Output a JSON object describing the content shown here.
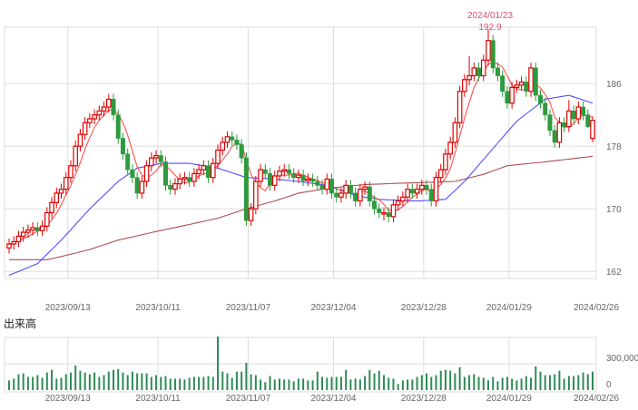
{
  "colors": {
    "up": "#e00000",
    "down": "#2e9a3e",
    "ma5": "#ff3030",
    "ma25": "#3030ff",
    "ma75": "#a03030",
    "volume": "#2e8b57",
    "grid": "#dddddd",
    "annotation": "#e05070"
  },
  "annotation": {
    "date": "2024/01/23",
    "value": "192.9"
  },
  "volume_title": "出来高",
  "chart_data": [
    {
      "type": "candlestick",
      "ylim": [
        161.1,
        193.2
      ],
      "y_ticks": [
        162,
        170,
        178,
        186
      ],
      "y_tick_labels": [
        "162",
        "170",
        "178",
        "186"
      ],
      "x_tick_labels": [
        "2023/09/13",
        "2023/10/11",
        "2023/11/07",
        "2023/12/04",
        "2023/12/28",
        "2024/01/29",
        "2024/02/26"
      ],
      "x_tick_index": [
        12,
        31,
        50,
        68,
        87,
        105,
        123
      ],
      "grid": true,
      "candles": [
        [
          165,
          166.2,
          164.3,
          165.5
        ],
        [
          165.5,
          166.5,
          164.8,
          165.8
        ],
        [
          165.8,
          167.2,
          165.1,
          166.5
        ],
        [
          166.5,
          167.7,
          165.8,
          167
        ],
        [
          167,
          168,
          166.3,
          167.3
        ],
        [
          167.3,
          168.3,
          166.6,
          167.6
        ],
        [
          167.6,
          168.3,
          166.5,
          167.2
        ],
        [
          167.2,
          168.5,
          166.5,
          167.8
        ],
        [
          167.8,
          170.2,
          167.1,
          169.5
        ],
        [
          169.5,
          171.5,
          168.8,
          170.8
        ],
        [
          170.8,
          172.7,
          170.1,
          172
        ],
        [
          172,
          173.2,
          171.3,
          172.5
        ],
        [
          172.5,
          174.7,
          171.8,
          174
        ],
        [
          174,
          176.2,
          173.3,
          175.5
        ],
        [
          175.5,
          178.7,
          174.8,
          178
        ],
        [
          178,
          180.2,
          177.3,
          179.5
        ],
        [
          179.5,
          181.7,
          178.8,
          181
        ],
        [
          181,
          182.2,
          180.3,
          181.5
        ],
        [
          181.5,
          182.7,
          180.8,
          182
        ],
        [
          182,
          183.2,
          181.3,
          182.5
        ],
        [
          182.5,
          183.7,
          181.8,
          183
        ],
        [
          183,
          184.7,
          182.3,
          184
        ],
        [
          184,
          184.7,
          181.3,
          182
        ],
        [
          182,
          182.7,
          178.3,
          179
        ],
        [
          179,
          179.7,
          176.3,
          177
        ],
        [
          177,
          177.7,
          174.3,
          175
        ],
        [
          175,
          175.7,
          173.3,
          174
        ],
        [
          174,
          174.7,
          171.3,
          172
        ],
        [
          172,
          174.2,
          171.3,
          173.5
        ],
        [
          173.5,
          176.2,
          172.8,
          175.5
        ],
        [
          175.5,
          177.2,
          174.8,
          176.5
        ],
        [
          176.5,
          177.5,
          175.8,
          176.8
        ],
        [
          176.8,
          177.5,
          175.3,
          176
        ],
        [
          176,
          176.7,
          172.3,
          173
        ],
        [
          173,
          173.7,
          171.8,
          172.5
        ],
        [
          172.5,
          173.9,
          171.8,
          173.2
        ],
        [
          173.2,
          174.5,
          172.5,
          173.8
        ],
        [
          173.8,
          174.7,
          173.1,
          174
        ],
        [
          174,
          174.7,
          172.8,
          173.5
        ],
        [
          173.5,
          175.2,
          172.8,
          174.5
        ],
        [
          174.5,
          175.7,
          173.8,
          175
        ],
        [
          175,
          176.2,
          174.3,
          175.5
        ],
        [
          175.5,
          176.2,
          173.3,
          174
        ],
        [
          174,
          176.5,
          173.3,
          175.8
        ],
        [
          175.8,
          178.2,
          175.1,
          177.5
        ],
        [
          177.5,
          179.2,
          176.8,
          178.5
        ],
        [
          178.5,
          179.9,
          177.8,
          179.2
        ],
        [
          179.2,
          179.9,
          178.1,
          178.8
        ],
        [
          178.8,
          179.5,
          177.5,
          178.2
        ],
        [
          178.2,
          178.9,
          175.8,
          176.5
        ],
        [
          176.5,
          177.2,
          167.8,
          168.5
        ],
        [
          168.5,
          170.7,
          167.8,
          170
        ],
        [
          170,
          174.2,
          169.3,
          173.5
        ],
        [
          173.5,
          175.7,
          172.8,
          175
        ],
        [
          175,
          175.7,
          173.8,
          174.5
        ],
        [
          174.5,
          175.2,
          172.3,
          173
        ],
        [
          173,
          174.9,
          172.3,
          174.2
        ],
        [
          174.2,
          175.5,
          173.5,
          174.8
        ],
        [
          174.8,
          175.7,
          174.1,
          175
        ],
        [
          175,
          175.7,
          173.8,
          174.5
        ],
        [
          174.5,
          175.2,
          173.3,
          174
        ],
        [
          174,
          175,
          173.3,
          174.3
        ],
        [
          174.3,
          175,
          172.9,
          173.6
        ],
        [
          173.6,
          174.5,
          172.9,
          173.8
        ],
        [
          173.8,
          174.5,
          172.8,
          173.5
        ],
        [
          173.5,
          174.2,
          172.3,
          173
        ],
        [
          173,
          173.7,
          171.8,
          172.5
        ],
        [
          172.5,
          174.5,
          171.8,
          173.8
        ],
        [
          173.8,
          174.5,
          171.3,
          172
        ],
        [
          172,
          172.7,
          170.8,
          171.5
        ],
        [
          171.5,
          172.7,
          170.8,
          172
        ],
        [
          172,
          173.7,
          171.3,
          173
        ],
        [
          173,
          173.7,
          171.3,
          172
        ],
        [
          172,
          172.7,
          170.3,
          171
        ],
        [
          171,
          173.2,
          170.3,
          172.5
        ],
        [
          172.5,
          173.5,
          171.8,
          172.8
        ],
        [
          172.8,
          173.5,
          170.3,
          171
        ],
        [
          171,
          171.7,
          169.3,
          170
        ],
        [
          170,
          170.7,
          168.8,
          169.5
        ],
        [
          169.5,
          170.2,
          168.5,
          169.5
        ],
        [
          169.5,
          170.2,
          168.3,
          169
        ],
        [
          169,
          171.2,
          168.3,
          170.5
        ],
        [
          170.5,
          171.7,
          169.8,
          171
        ],
        [
          171,
          172.2,
          170.3,
          171.5
        ],
        [
          171.5,
          173.2,
          170.8,
          172.5
        ],
        [
          172.5,
          173.2,
          171.3,
          172
        ],
        [
          172,
          173.2,
          171.3,
          172.5
        ],
        [
          172.5,
          173.7,
          171.8,
          173
        ],
        [
          173,
          173.7,
          171.8,
          172.5
        ],
        [
          172.5,
          173.2,
          170.3,
          171
        ],
        [
          171,
          174.7,
          170.3,
          174
        ],
        [
          174,
          175.7,
          173.3,
          175
        ],
        [
          175,
          177.7,
          174.3,
          177
        ],
        [
          177,
          179.2,
          176.3,
          178.5
        ],
        [
          178.5,
          181.7,
          177.8,
          181
        ],
        [
          181,
          185.7,
          180.3,
          185
        ],
        [
          185,
          187.2,
          184.3,
          186.5
        ],
        [
          186.5,
          189.5,
          185.8,
          187
        ],
        [
          187,
          188.7,
          186.3,
          188
        ],
        [
          188,
          188.7,
          186.3,
          187
        ],
        [
          187,
          189.7,
          186.3,
          189
        ],
        [
          189,
          192.9,
          188.3,
          191.5
        ],
        [
          191.5,
          192.2,
          187.3,
          188
        ],
        [
          188,
          188.7,
          186.3,
          187
        ],
        [
          187,
          187.7,
          184.3,
          185
        ],
        [
          185,
          185.7,
          182.8,
          183.5
        ],
        [
          183.5,
          186.2,
          182.8,
          185.5
        ],
        [
          185.5,
          186.5,
          184.8,
          185.8
        ],
        [
          185.8,
          186.9,
          185.1,
          186.2
        ],
        [
          186.2,
          186.9,
          184.3,
          185
        ],
        [
          185,
          188.7,
          184.3,
          188
        ],
        [
          188,
          188.7,
          183.8,
          184.5
        ],
        [
          184.5,
          185.2,
          182.8,
          183.5
        ],
        [
          183.5,
          184.2,
          181.3,
          182
        ],
        [
          182,
          182.7,
          179.3,
          180
        ],
        [
          180,
          180.7,
          177.8,
          178.5
        ],
        [
          178.5,
          181.7,
          177.8,
          181
        ],
        [
          181,
          181.7,
          179.8,
          180.5
        ],
        [
          180.5,
          183.9,
          179.8,
          182.5
        ],
        [
          182.5,
          183.2,
          180.8,
          181.5
        ],
        [
          181.5,
          183.7,
          180.8,
          183
        ],
        [
          183,
          183.7,
          181.3,
          182
        ],
        [
          182,
          182.7,
          180.3,
          180.5
        ],
        [
          179,
          181.8,
          178.5,
          181.3
        ]
      ],
      "ma25_points": [
        [
          0,
          161.5
        ],
        [
          6,
          163
        ],
        [
          11,
          166
        ],
        [
          17,
          170
        ],
        [
          23,
          173.5
        ],
        [
          27,
          175.2
        ],
        [
          32,
          175.8
        ],
        [
          38,
          175.8
        ],
        [
          44,
          175.2
        ],
        [
          50,
          174
        ],
        [
          56,
          173.8
        ],
        [
          61,
          173.5
        ],
        [
          67,
          173
        ],
        [
          73,
          171.7
        ],
        [
          78,
          171.2
        ],
        [
          86,
          171
        ],
        [
          92,
          171.2
        ],
        [
          96,
          173.5
        ],
        [
          101,
          177
        ],
        [
          107,
          181.2
        ],
        [
          113,
          184
        ],
        [
          118,
          184.5
        ],
        [
          123,
          183.5
        ]
      ],
      "ma75_points": [
        [
          0,
          163.5
        ],
        [
          8,
          163.5
        ],
        [
          11,
          163.9
        ],
        [
          17,
          164.8
        ],
        [
          23,
          166
        ],
        [
          31,
          167.1
        ],
        [
          38,
          168
        ],
        [
          44,
          168.8
        ],
        [
          50,
          170
        ],
        [
          56,
          171
        ],
        [
          61,
          172
        ],
        [
          67,
          172.6
        ],
        [
          75,
          173.1
        ],
        [
          84,
          173.3
        ],
        [
          94,
          173.5
        ],
        [
          100,
          174.4
        ],
        [
          105,
          175.5
        ],
        [
          113,
          176
        ],
        [
          123,
          176.7
        ]
      ]
    },
    {
      "type": "bar",
      "title": "出来高",
      "ylim": [
        0,
        600000
      ],
      "y_ticks": [
        0,
        300000
      ],
      "y_tick_labels": [
        "0",
        "300,000"
      ],
      "x_tick_labels": [
        "2023/09/13",
        "2023/10/11",
        "2023/11/07",
        "2023/12/04",
        "2023/12/28",
        "2024/01/29",
        "2024/02/26"
      ],
      "values_thousands": [
        110,
        130,
        180,
        190,
        150,
        150,
        170,
        140,
        200,
        230,
        130,
        140,
        180,
        200,
        280,
        220,
        200,
        180,
        200,
        150,
        170,
        210,
        230,
        240,
        200,
        170,
        210,
        190,
        190,
        190,
        150,
        170,
        150,
        160,
        130,
        130,
        130,
        120,
        140,
        150,
        150,
        150,
        160,
        150,
        610,
        210,
        190,
        140,
        210,
        210,
        310,
        180,
        170,
        120,
        90,
        160,
        120,
        130,
        120,
        120,
        100,
        130,
        130,
        110,
        110,
        210,
        150,
        140,
        150,
        150,
        150,
        230,
        120,
        130,
        120,
        160,
        230,
        190,
        220,
        170,
        140,
        130,
        70,
        110,
        120,
        120,
        150,
        170,
        190,
        150,
        170,
        220,
        230,
        220,
        190,
        260,
        150,
        170,
        180,
        150,
        140,
        110,
        150,
        100,
        140,
        150,
        130,
        110,
        130,
        160,
        140,
        270,
        210,
        170,
        170,
        180,
        220,
        130,
        160,
        160,
        170,
        200,
        180,
        210
      ]
    }
  ]
}
